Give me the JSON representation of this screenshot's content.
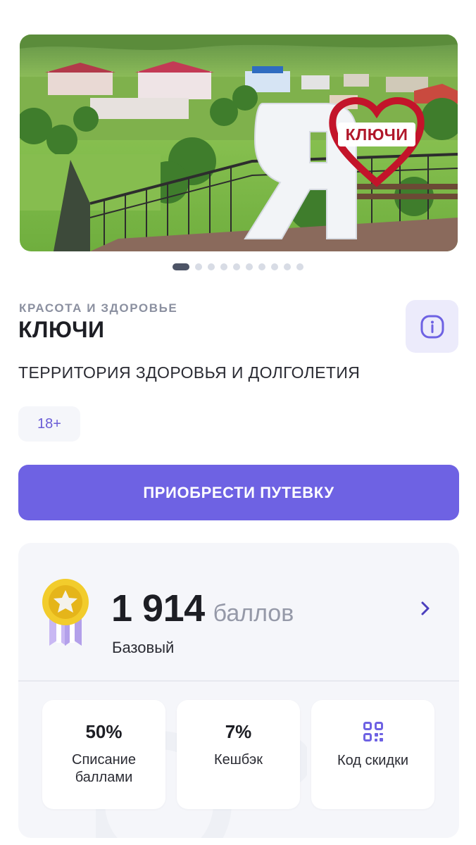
{
  "hero": {
    "sign_text": "КЛЮЧИ",
    "letter": "Я"
  },
  "carousel": {
    "count": 10,
    "active_index": 0
  },
  "place": {
    "category": "КРАСОТА И ЗДОРОВЬЕ",
    "title": "КЛЮЧИ",
    "subtitle": "ТЕРРИТОРИЯ ЗДОРОВЬЯ И ДОЛГОЛЕТИЯ",
    "age_limit": "18+",
    "info_icon": "info-icon"
  },
  "cta": {
    "label": "ПРИОБРЕСТИ ПУТЕВКУ"
  },
  "loyalty": {
    "points_value": "1 914",
    "points_unit": "баллов",
    "level": "Базовый",
    "tiles": [
      {
        "value": "50%",
        "label": "Списание баллами"
      },
      {
        "value": "7%",
        "label": "Кешбэк"
      },
      {
        "icon": "qr-code-icon",
        "label": "Код скидки"
      }
    ]
  },
  "colors": {
    "accent": "#6e62e3",
    "accent_light": "#ecebfb",
    "muted": "#8b90a0",
    "card_bg": "#f5f6fa"
  }
}
